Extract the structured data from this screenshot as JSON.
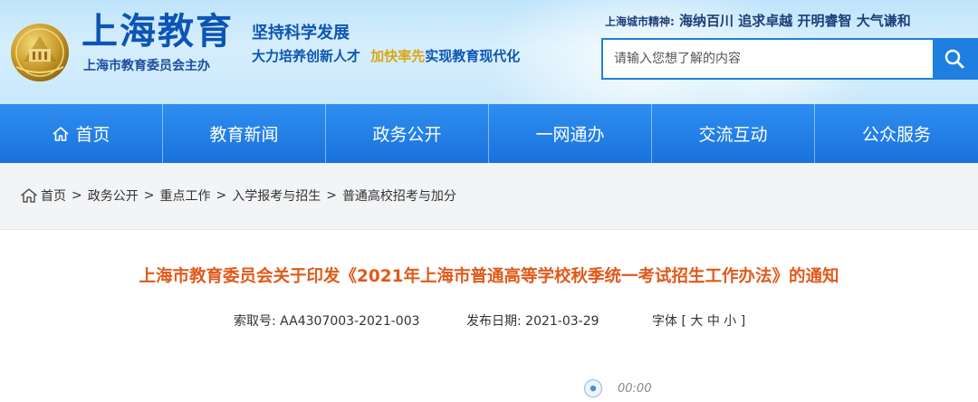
{
  "header": {
    "logo_text": "上海教育",
    "logo_subtitle": "上海市教育委员会主办",
    "slogan_line1": "坚持科学发展",
    "slogan_line2_part1": "大力培养创新人才",
    "slogan_line2_part2": "加快率先",
    "slogan_line2_part3": "实现教育现代化",
    "city_spirit_label": "上海城市精神:",
    "city_spirit_text": "海纳百川 追求卓越 开明睿智 大气谦和",
    "search_placeholder": "请输入您想了解的内容"
  },
  "nav": {
    "items": [
      {
        "label": "首页"
      },
      {
        "label": "教育新闻"
      },
      {
        "label": "政务公开"
      },
      {
        "label": "一网通办"
      },
      {
        "label": "交流互动"
      },
      {
        "label": "公众服务"
      }
    ]
  },
  "breadcrumb": {
    "items": [
      "首页",
      "政务公开",
      "重点工作",
      "入学报考与招生",
      "普通高校招考与加分"
    ],
    "separator": ">"
  },
  "article": {
    "title": "上海市教育委员会关于印发《2021年上海市普通高等学校秋季统一考试招生工作办法》的通知",
    "index_label": "索取号:",
    "index_value": "AA4307003-2021-003",
    "date_label": "发布日期:",
    "date_value": "2021-03-29",
    "font_label": "字体",
    "font_open": "[",
    "font_large": "大",
    "font_medium": "中",
    "font_small": "小",
    "font_close": "]",
    "audio_time": "00:00"
  },
  "colors": {
    "nav_blue": "#1e7fe0",
    "title_orange": "#e05a1a",
    "logo_blue": "#0c55b5",
    "slogan_gold": "#d6a816"
  }
}
